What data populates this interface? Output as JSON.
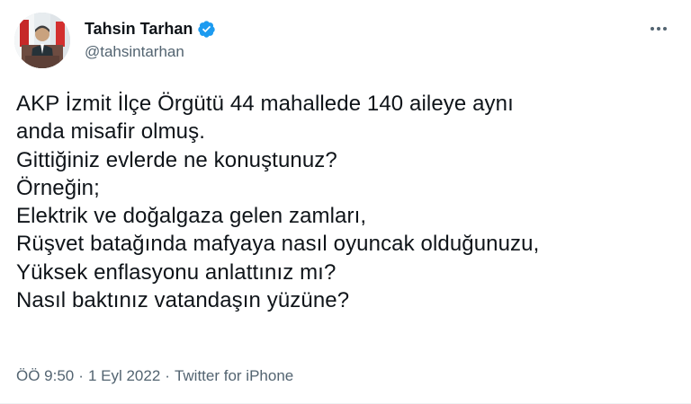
{
  "author": {
    "name": "Tahsin Tarhan",
    "handle": "@tahsintarhan",
    "verified": true
  },
  "tweet": {
    "lines": [
      "AKP İzmit İlçe Örgütü 44 mahallede 140 aileye aynı",
      "anda misafir olmuş.",
      "Gittiğiniz evlerde ne konuştunuz?",
      "Örneğin;",
      "Elektrik ve doğalgaza gelen zamları,",
      "Rüşvet batağında mafyaya nasıl oyuncak olduğunuzu,",
      "Yüksek enflasyonu anlattınız mı?",
      "Nasıl baktınız vatandaşın yüzüne?"
    ]
  },
  "meta": {
    "time": "ÖÖ 9:50",
    "separator": "·",
    "date": "1 Eyl 2022",
    "source": "Twitter for iPhone"
  },
  "colors": {
    "text": "#0f1419",
    "secondary": "#536471",
    "verified": "#1d9bf0"
  },
  "icons": {
    "verified": "verified-badge-icon",
    "more": "more-dots-icon"
  }
}
